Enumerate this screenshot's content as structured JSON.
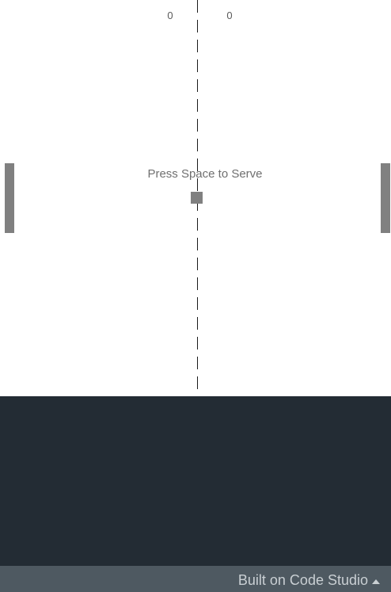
{
  "game": {
    "score_left": "0",
    "score_right": "0",
    "serve_message": "Press Space to Serve"
  },
  "footer": {
    "link_label": "Built on Code Studio",
    "icon": "caret-up-icon"
  },
  "colors": {
    "court": "#ffffff",
    "paddle": "#808080",
    "ball": "#808080",
    "net": "#1a1a1a",
    "panel": "#232c34",
    "footer": "#4e5961",
    "footer_text": "#c9cfd3"
  }
}
